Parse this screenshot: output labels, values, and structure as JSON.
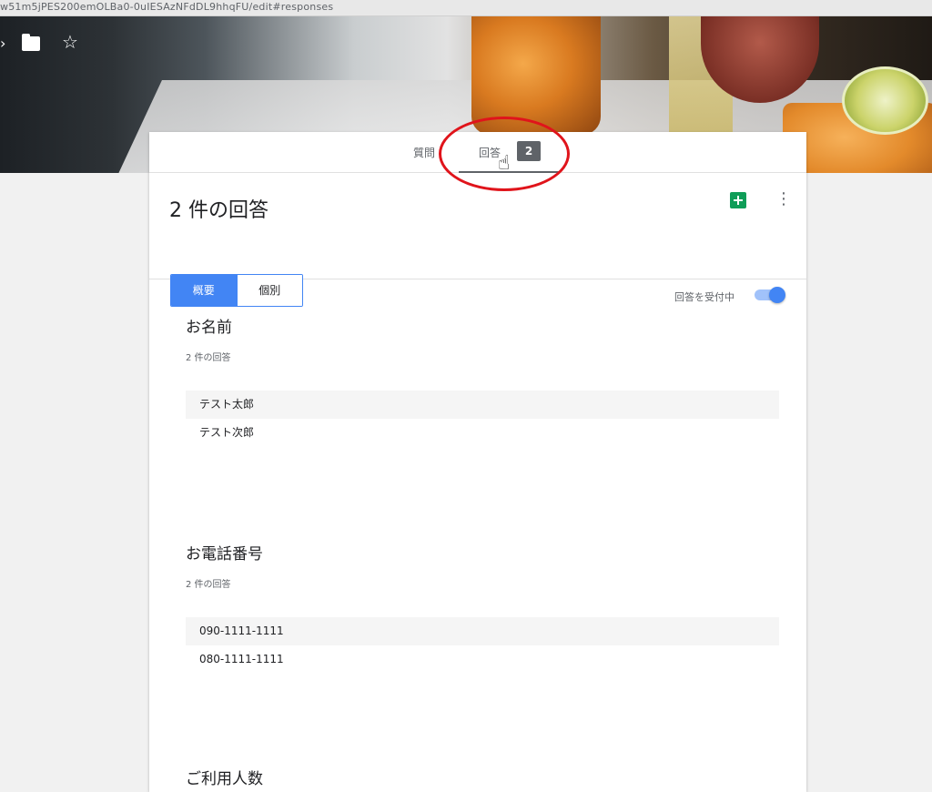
{
  "browser": {
    "url": "w51m5jPES200emOLBa0-0uIESAzNFdDL9hhqFU/edit#responses"
  },
  "tabs": {
    "questions_label": "質問",
    "responses_label": "回答",
    "responses_badge": "2"
  },
  "header": {
    "title": "2 件の回答",
    "summary_label": "概要",
    "individual_label": "個別",
    "accepting_label": "回答を受付中"
  },
  "sections": [
    {
      "title": "お名前",
      "count": "2 件の回答",
      "answers": [
        "テスト太郎",
        "テスト次郎"
      ]
    },
    {
      "title": "お電話番号",
      "count": "2 件の回答",
      "answers": [
        "090-1111-1111",
        "080-1111-1111"
      ]
    },
    {
      "title": "ご利用人数"
    }
  ],
  "colors": {
    "accent": "#4285f4",
    "sheets": "#0f9d58",
    "annotation": "#e0141b"
  },
  "icons": [
    "folder-icon",
    "star-icon",
    "sheets-icon",
    "more-vert-icon",
    "hand-cursor-icon"
  ]
}
